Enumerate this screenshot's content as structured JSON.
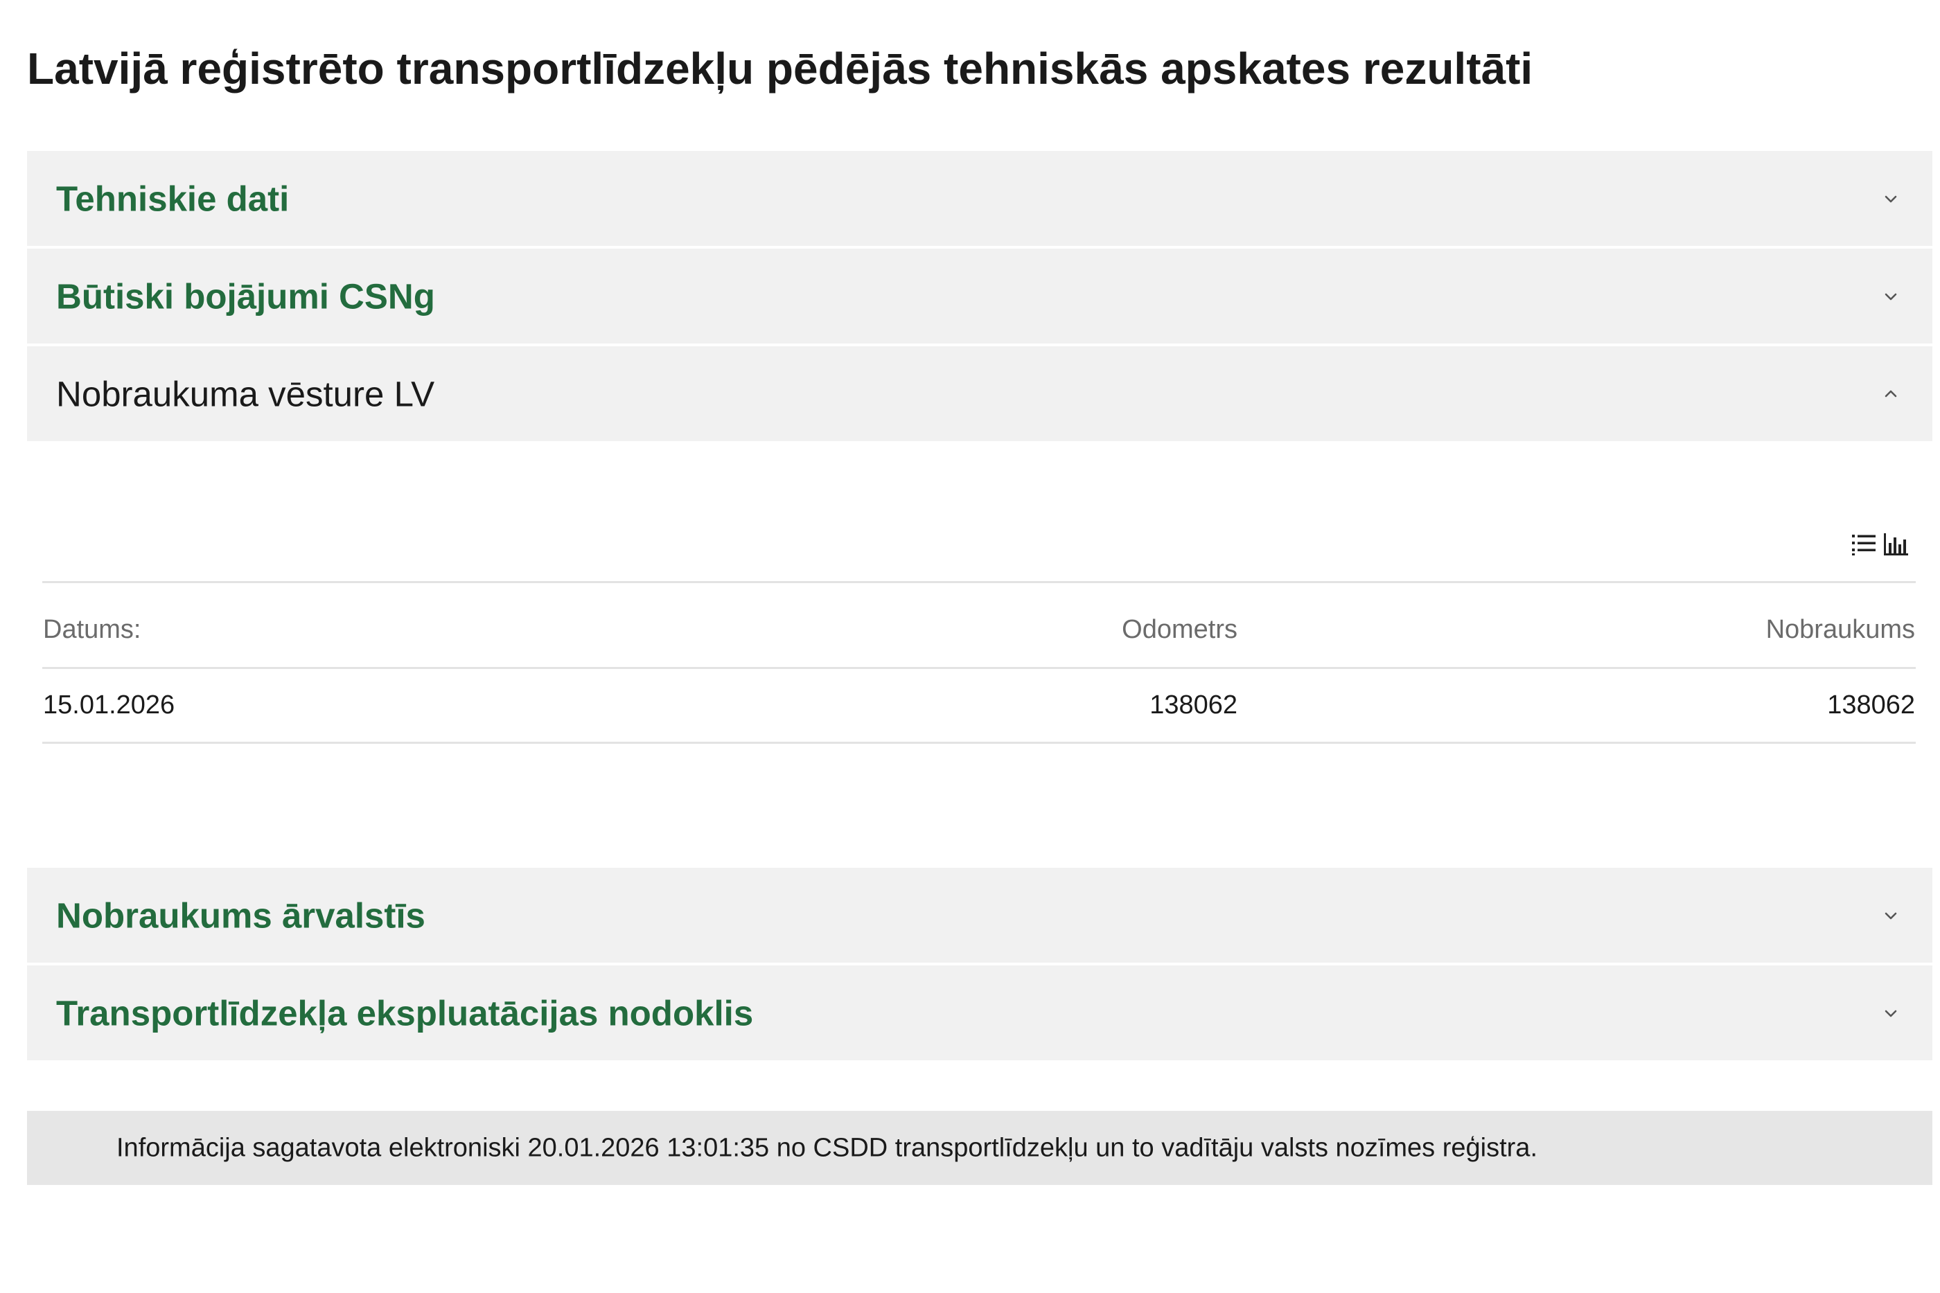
{
  "page": {
    "title": "Latvijā reģistrēto transportlīdzekļu pēdējās tehniskās apskates rezultāti"
  },
  "accordion": {
    "items": [
      {
        "label": "Tehniskie dati",
        "expanded": false,
        "icon": "chevron-down-icon"
      },
      {
        "label": "Būtiski bojājumi CSNg",
        "expanded": false,
        "icon": "chevron-down-icon"
      },
      {
        "label": "Nobraukuma vēsture LV",
        "expanded": true,
        "icon": "chevron-up-icon"
      },
      {
        "label": "Nobraukums ārvalstīs",
        "expanded": false,
        "icon": "chevron-down-icon"
      },
      {
        "label": "Transportlīdzekļa ekspluatācijas nodoklis",
        "expanded": false,
        "icon": "chevron-down-icon"
      }
    ]
  },
  "mileage_history": {
    "view_icons": [
      "list-view-icon",
      "bar-chart-view-icon"
    ],
    "columns": [
      "Datums:",
      "Odometrs",
      "Nobraukums"
    ],
    "rows": [
      {
        "date": "15.01.2026",
        "odometer": "138062",
        "mileage": "138062"
      }
    ]
  },
  "footer": {
    "text": "Informācija sagatavota elektroniski 20.01.2026 13:01:35 no CSDD transportlīdzekļu un to vadītāju valsts nozīmes reģistra."
  },
  "colors": {
    "accent_green": "#236c3e",
    "accordion_bg": "#f1f1f1",
    "footer_bg": "#e6e6e6",
    "header_text": "#6b6b6b",
    "rule": "#e3e3e3"
  }
}
